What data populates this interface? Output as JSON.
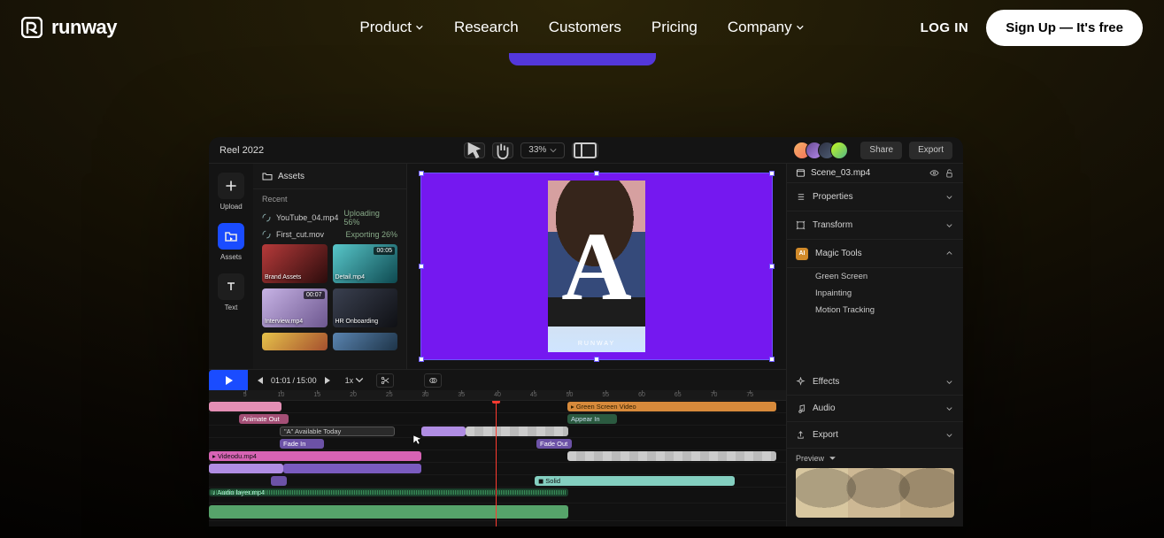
{
  "nav": {
    "brand": "runway",
    "links": {
      "product": "Product",
      "research": "Research",
      "customers": "Customers",
      "pricing": "Pricing",
      "company": "Company"
    },
    "login": "LOG IN",
    "signup": "Sign Up — It's free"
  },
  "editor": {
    "project_title": "Reel 2022",
    "zoom": "33%",
    "share": "Share",
    "export": "Export",
    "rail": {
      "upload": "Upload",
      "assets": "Assets",
      "text": "Text"
    },
    "assets_panel": {
      "title": "Assets",
      "recent": "Recent",
      "rows": [
        {
          "name": "YouTube_04.mp4",
          "status": "Uploading 56%"
        },
        {
          "name": "First_cut.mov",
          "status": "Exporting 26%"
        }
      ],
      "thumbs": [
        {
          "caption": "Brand Assets",
          "duration": ""
        },
        {
          "caption": "Detail.mp4",
          "duration": "00:05"
        },
        {
          "caption": "Interview.mp4",
          "duration": "00:07"
        },
        {
          "caption": "HR Onboarding",
          "duration": ""
        }
      ]
    },
    "poster_label": "RUNWAY",
    "inspector": {
      "filename": "Scene_03.mp4",
      "properties": "Properties",
      "transform": "Transform",
      "magic": "Magic Tools",
      "magic_badge": "AI",
      "magic_items": {
        "green": "Green Screen",
        "inpaint": "Inpainting",
        "track": "Motion Tracking"
      },
      "effects": "Effects",
      "audio": "Audio",
      "export": "Export",
      "preview": "Preview"
    },
    "transport": {
      "time_current": "01:01",
      "time_sep": " / ",
      "time_total": "15:00",
      "speed": "1x"
    },
    "ruler": [
      "5",
      "10",
      "15",
      "20",
      "25",
      "30",
      "35",
      "40",
      "45",
      "50",
      "55",
      "60",
      "65",
      "70",
      "75"
    ],
    "clips": {
      "animate_out": "Animate Out",
      "green_screen": "▸ Green Screen Video",
      "appear_in": "Appear In",
      "available": "\"A\" Available Today",
      "fade_in": "Fade In",
      "fade_out": "Fade Out",
      "videodu": "▸ Videodu.mp4",
      "solid": "◼ Solid",
      "audio_layer": "♪  Audio layer.mp4"
    }
  }
}
